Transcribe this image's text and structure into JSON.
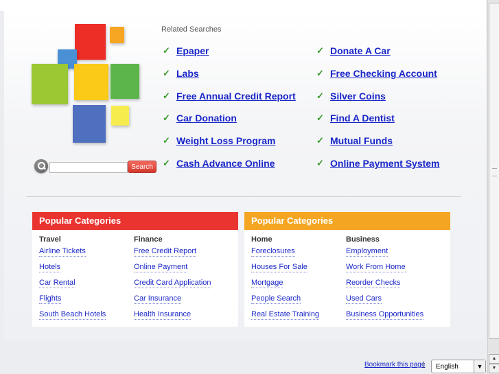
{
  "related": {
    "title": "Related Searches",
    "links": [
      "Epaper",
      "Donate A Car",
      "Labs",
      "Free Checking Account",
      "Free Annual Credit Report",
      "Silver Coins",
      "Car Donation",
      "Find A Dentist",
      "Weight Loss Program",
      "Mutual Funds",
      "Cash Advance Online",
      "Online Payment System"
    ]
  },
  "search": {
    "button_label": "Search",
    "value": "",
    "icon": "search-icon"
  },
  "categories": [
    {
      "header": "Popular Categories",
      "color": "#ea3430",
      "columns": [
        {
          "title": "Travel",
          "items": [
            "Airline Tickets",
            "Hotels",
            "Car Rental",
            "Flights",
            "South Beach Hotels"
          ]
        },
        {
          "title": "Finance",
          "items": [
            "Free Credit Report",
            "Online Payment",
            "Credit Card Application",
            "Car Insurance",
            "Health Insurance"
          ]
        }
      ]
    },
    {
      "header": "Popular Categories",
      "color": "#f4a622",
      "columns": [
        {
          "title": "Home",
          "items": [
            "Foreclosures",
            "Houses For Sale",
            "Mortgage",
            "People Search",
            "Real Estate Training"
          ]
        },
        {
          "title": "Business",
          "items": [
            "Employment",
            "Work From Home",
            "Reorder Checks",
            "Used Cars",
            "Business Opportunities"
          ]
        }
      ]
    }
  ],
  "footer": {
    "bookmark_label": "Bookmark this page",
    "separator": "|",
    "language": "English"
  },
  "colors": {
    "link": "#1a27c9",
    "check": "#3a9a2a"
  }
}
